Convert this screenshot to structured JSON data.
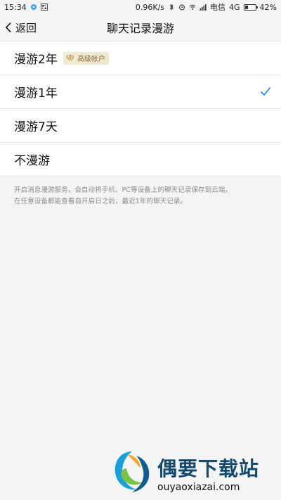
{
  "status_bar": {
    "time": "15:34",
    "speed": "0.96K/s",
    "carrier": "电信",
    "network": "4G",
    "battery": "42%",
    "battery_level": 0.42,
    "icons": [
      "notification-icon",
      "qr-icon",
      "bluetooth-icon",
      "alarm-icon",
      "wifi-icon",
      "signal-icon",
      "battery-icon"
    ]
  },
  "navbar": {
    "back_label": "返回",
    "title": "聊天记录漫游"
  },
  "options": [
    {
      "label": "漫游2年",
      "badge": "高级帐户",
      "selected": false
    },
    {
      "label": "漫游1年",
      "selected": true
    },
    {
      "label": "漫游7天",
      "selected": false
    },
    {
      "label": "不漫游",
      "selected": false
    }
  ],
  "description": {
    "line1": "开启消息漫游服务，会自动将手机、PC等设备上的聊天记录保存到云端，",
    "line2": "在任意设备都能查看自开启日之后，最近1年的聊天记录。"
  },
  "watermark": {
    "name": "偶要下载站",
    "url": "ouyaoxiazai.com"
  },
  "colors": {
    "accent": "#1e8ae6",
    "badge_text": "#8a6e3b",
    "watermark_text": "#12496d"
  }
}
